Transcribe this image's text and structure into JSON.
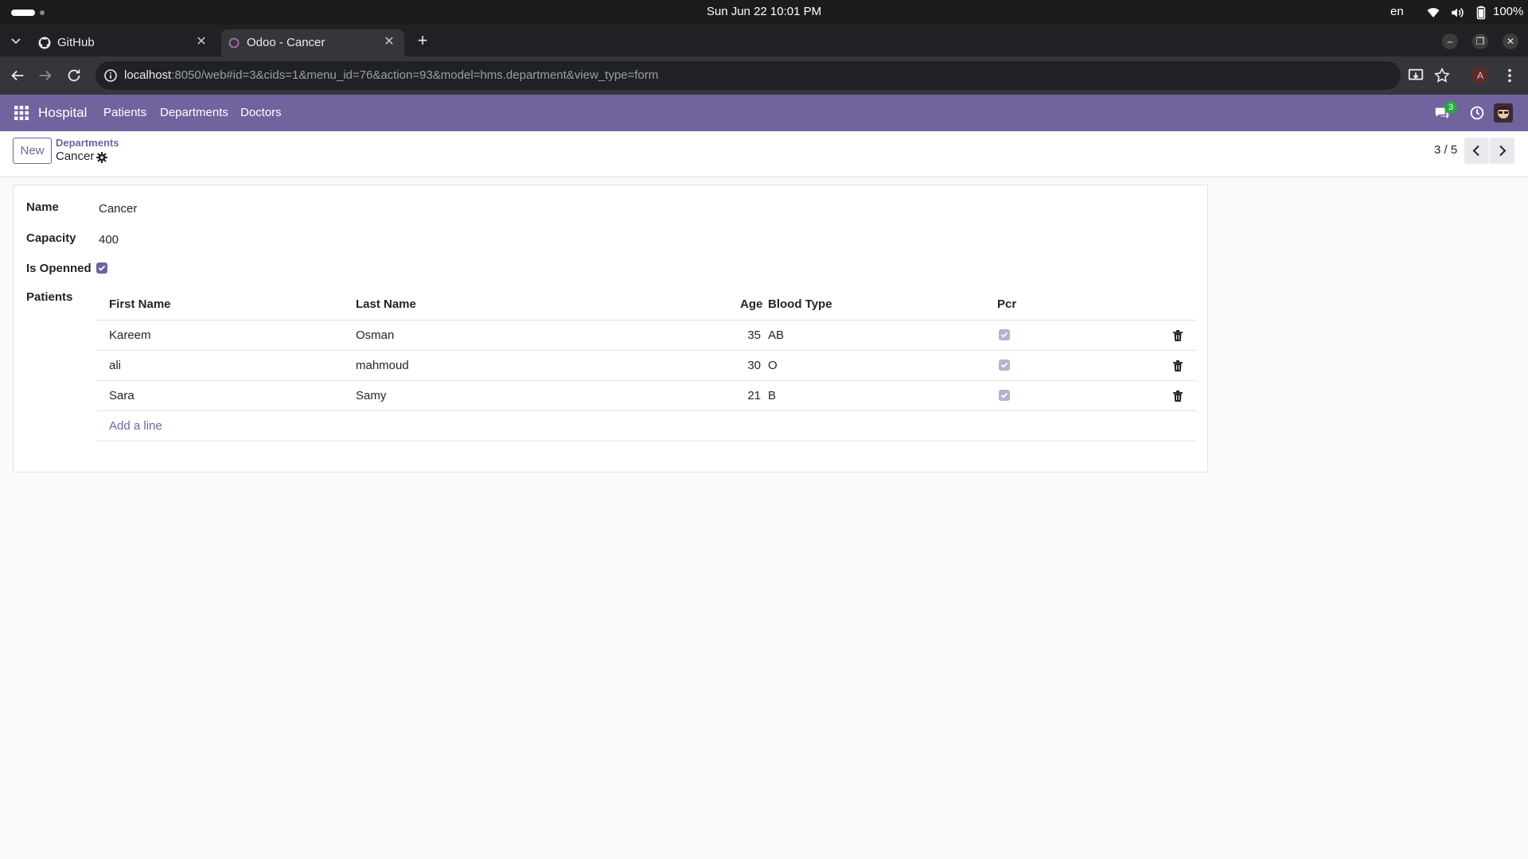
{
  "os": {
    "clock": "Sun Jun 22  10:01 PM",
    "lang": "en",
    "battery": "100%"
  },
  "browser": {
    "tabs": [
      {
        "title": "GitHub",
        "icon": "github-icon"
      },
      {
        "title": "Odoo - Cancer",
        "icon": "odoo-icon"
      }
    ],
    "url_host": "localhost",
    "url_rest": ":8050/web#id=3&cids=1&menu_id=76&action=93&model=hms.department&view_type=form",
    "profile_initial": "A"
  },
  "navbar": {
    "brand": "Hospital",
    "menu": [
      "Patients",
      "Departments",
      "Doctors"
    ],
    "chat_count": "3",
    "color": "#71639e"
  },
  "control_panel": {
    "new_label": "New",
    "breadcrumb_parent": "Departments",
    "breadcrumb_current": "Cancer",
    "pager": "3 / 5"
  },
  "form": {
    "fields": {
      "name_label": "Name",
      "name_value": "Cancer",
      "capacity_label": "Capacity",
      "capacity_value": "400",
      "is_opened_label": "Is Openned",
      "is_opened_value": true,
      "patients_label": "Patients"
    },
    "patients": {
      "columns": [
        "First Name",
        "Last Name",
        "Age",
        "Blood Type",
        "Pcr"
      ],
      "rows": [
        {
          "first_name": "Kareem",
          "last_name": "Osman",
          "age": "35",
          "blood_type": "AB",
          "pcr": true
        },
        {
          "first_name": "ali",
          "last_name": "mahmoud",
          "age": "30",
          "blood_type": "O",
          "pcr": true
        },
        {
          "first_name": "Sara",
          "last_name": "Samy",
          "age": "21",
          "blood_type": "B",
          "pcr": true
        }
      ],
      "add_line_label": "Add a line"
    }
  }
}
